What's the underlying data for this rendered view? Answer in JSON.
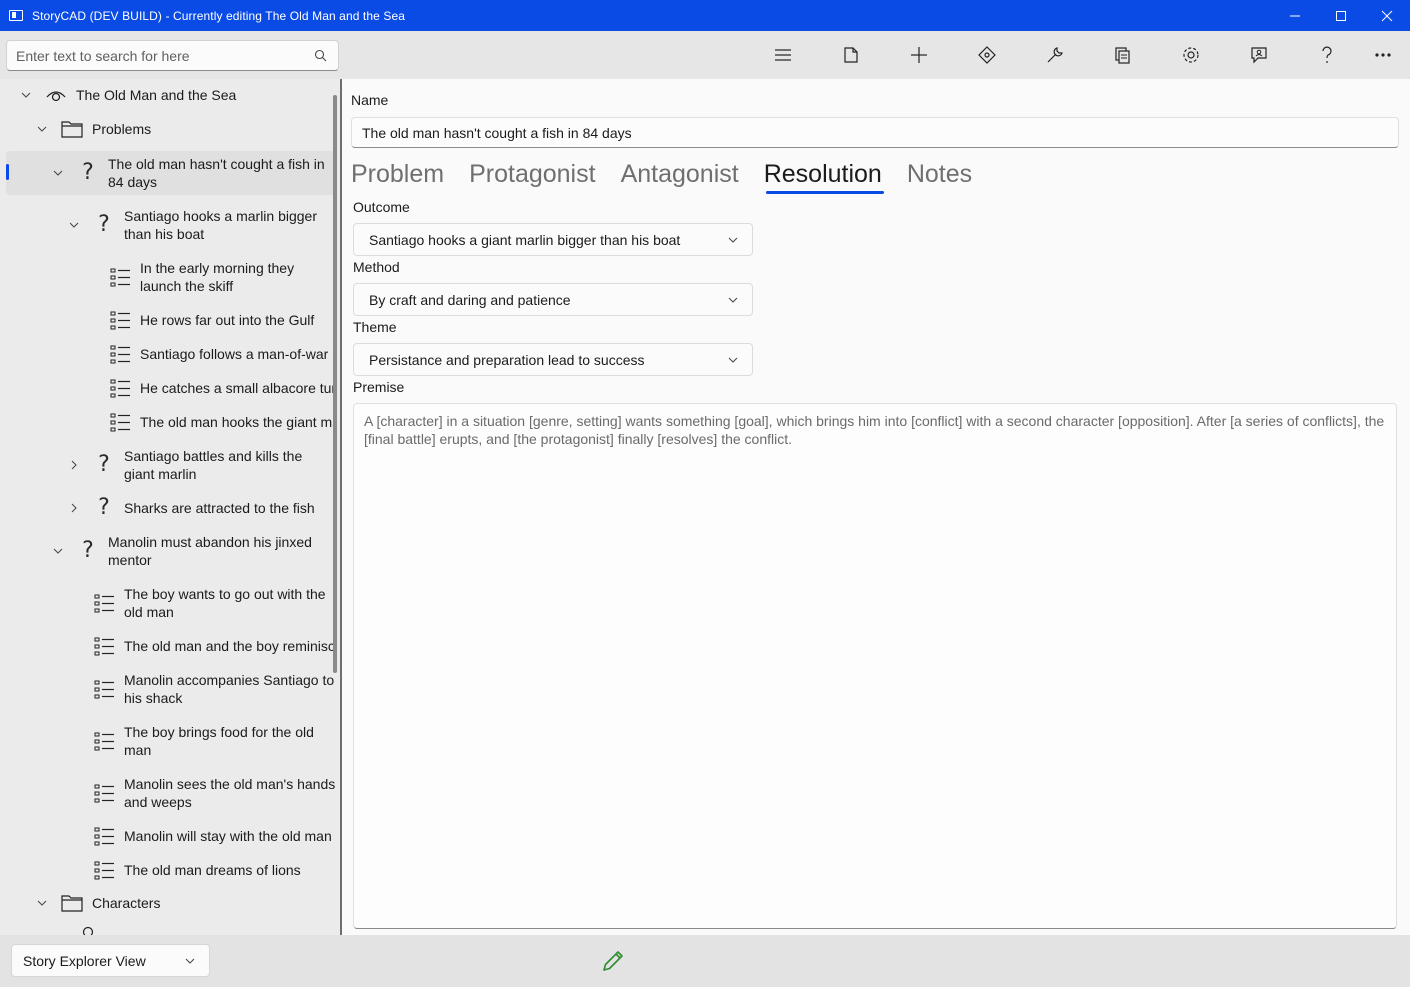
{
  "window": {
    "title": "StoryCAD (DEV BUILD) - Currently editing The Old Man and the Sea",
    "icons": [
      "minimize-icon",
      "maximize-icon",
      "close-icon"
    ]
  },
  "search": {
    "placeholder": "Enter text to search for here",
    "value": ""
  },
  "toolbar": {
    "icons": [
      "hamburger-menu-icon",
      "new-file-icon",
      "add-icon",
      "move-icon",
      "tools-icon",
      "copy-pages-icon",
      "settings-icon",
      "feedback-icon",
      "help-icon",
      "more-icon"
    ]
  },
  "tree": {
    "root": "The Old Man and the Sea",
    "problems_folder": "Problems",
    "selected": "The old man hasn't cought a fish in 84 days",
    "problem2": "Santiago hooks a marlin bigger than his boat",
    "scene1": "In the early morning they launch the skiff",
    "scene2": "He rows far out into the Gulf",
    "scene3": "Santiago follows a man-of-war",
    "scene4": "He catches a small albacore tuna",
    "scene5": "The old man hooks the giant marlin",
    "problem3": "Santiago battles and kills the giant marlin",
    "problem4": "Sharks are attracted to the fish",
    "problem5": "Manolin must abandon his jinxed mentor",
    "scene6": "The boy wants to go out with the old man",
    "scene7": "The old man and the boy reminisce",
    "scene8": "Manolin accompanies Santiago to his shack",
    "scene9": "The boy brings food for the old man",
    "scene10": "Manolin sees the old man's hands and weeps",
    "scene11": "Manolin will stay with the old man",
    "scene12": "The old man dreams of lions",
    "characters_folder": "Characters"
  },
  "form": {
    "name_label": "Name",
    "name_value": "The old man hasn't cought a fish in 84 days",
    "tabs": [
      "Problem",
      "Protagonist",
      "Antagonist",
      "Resolution",
      "Notes"
    ],
    "active_tab": "Resolution",
    "outcome_label": "Outcome",
    "outcome_value": "Santiago hooks a giant marlin bigger than his boat",
    "method_label": "Method",
    "method_value": "By craft and daring and patience",
    "theme_label": "Theme",
    "theme_value": "Persistance and preparation lead to success",
    "premise_label": "Premise",
    "premise_text": "A [character] in a situation [genre, setting] wants something [goal], which brings him into [conflict] with a second character [opposition]. After [a series of conflicts], the [final battle] erupts, and [the protagonist] finally [resolves] the conflict."
  },
  "status": {
    "view_mode": "Story Explorer View",
    "edit_icon": "pencil-icon",
    "edit_color": "#2e8b2e"
  },
  "colors": {
    "accent": "#0a4be6"
  }
}
